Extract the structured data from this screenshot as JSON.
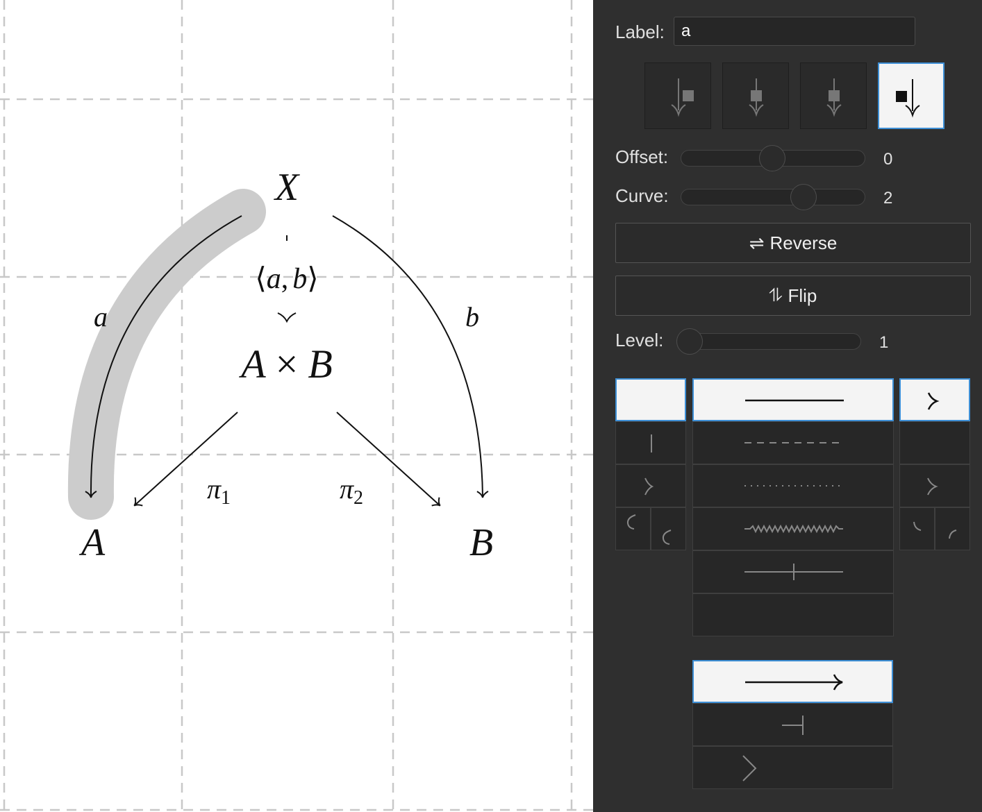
{
  "diagram": {
    "nodes": {
      "X": "X",
      "AxB_A": "A",
      "AxB_times": "×",
      "AxB_B": "B",
      "A": "A",
      "B": "B"
    },
    "edges": {
      "a_label": "a",
      "b_label": "b",
      "pair_open": "⟨",
      "pair_a": "a",
      "pair_comma": ",",
      "pair_b": "b",
      "pair_close": "⟩",
      "pi1_base": "π",
      "pi1_sub": "1",
      "pi2_base": "π",
      "pi2_sub": "2"
    },
    "selected_edge": "a"
  },
  "panel": {
    "label_caption": "Label:",
    "label_value": "a",
    "label_positions": [
      "left",
      "centre-above",
      "centre-below",
      "right"
    ],
    "label_position_selected": "right",
    "offset_caption": "Offset:",
    "offset_value": "0",
    "curve_caption": "Curve:",
    "curve_value": "2",
    "reverse_icon": "⇌",
    "reverse_label": "Reverse",
    "flip_icon": "⥮",
    "flip_label": "Flip",
    "level_caption": "Level:",
    "level_value": "1",
    "tail_styles": [
      "none",
      "maps-to",
      "mono",
      "hook-top",
      "hook-bottom"
    ],
    "tail_selected": "none",
    "body_styles": [
      "solid",
      "dashed",
      "dotted",
      "squiggly",
      "barred",
      "none"
    ],
    "body_selected": "solid",
    "head_styles": [
      "arrowhead",
      "none",
      "epi",
      "harpoon-top",
      "harpoon-bottom"
    ],
    "head_selected": "arrowhead",
    "edge_types": [
      "arrow",
      "adjunction",
      "corner"
    ],
    "edge_type_selected": "arrow",
    "accent_color": "#3d8fd6",
    "selection_highlight_color": "#cccccc"
  }
}
